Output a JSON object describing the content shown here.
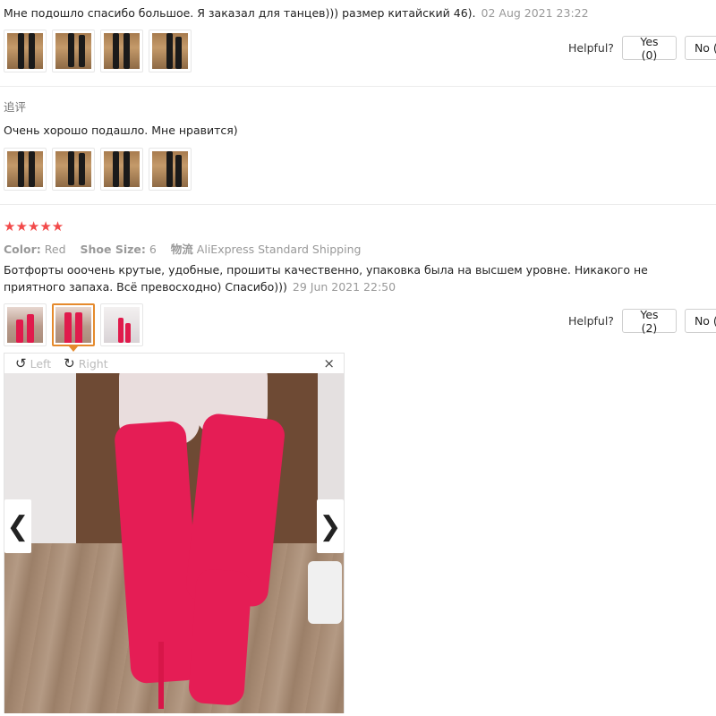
{
  "review1": {
    "text": "Мне подошло спасибо большое. Я заказал для танцев))) размер китайский 46).",
    "date": "02 Aug 2021 23:22",
    "helpful_label": "Helpful?",
    "yes_label": "Yes (0)",
    "no_label": "No ("
  },
  "followup": {
    "title": "追评",
    "text": "Очень хорошо подашло. Мне нравится)"
  },
  "review2": {
    "stars": "★★★★★",
    "color_key": "Color:",
    "color_val": "Red",
    "size_key": "Shoe Size:",
    "size_val": "6",
    "ship_key": "物流",
    "ship_val": "AliExpress Standard Shipping",
    "text_line1": "Ботфорты ооочень крутые, удобные, прошиты качественно, упаковка была на высшем уровне. Никакого не",
    "text_line2": "приятного запаха. Всё превосходно) Спасибо)))",
    "date": "29 Jun 2021 22:50",
    "helpful_label": "Helpful?",
    "yes_label": "Yes (2)",
    "no_label": "No ("
  },
  "viewer": {
    "rotate_left_icon": "↺",
    "left_label": "Left",
    "rotate_right_icon": "↻",
    "right_label": "Right",
    "close_icon": "×",
    "prev_icon": "❮",
    "next_icon": "❯"
  },
  "colors": {
    "star": "#f24a4a",
    "selected_border": "#e58a2d",
    "boot_red": "#e51d55"
  }
}
